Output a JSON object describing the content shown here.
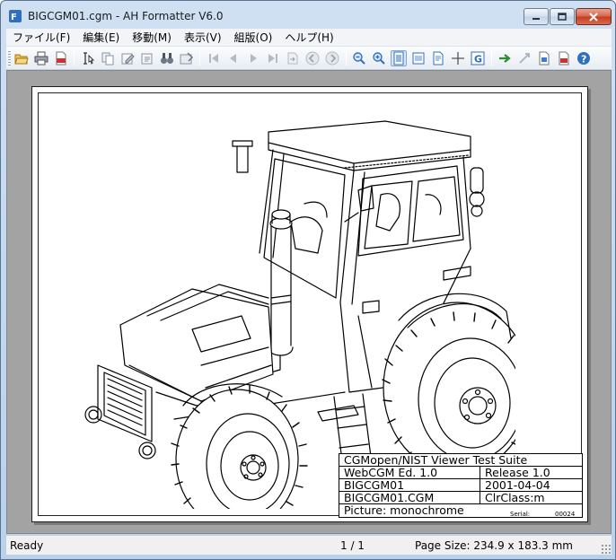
{
  "window": {
    "title": "BIGCGM01.cgm - AH Formatter V6.0",
    "app_icon": "ah-formatter-icon"
  },
  "caption_buttons": [
    {
      "name": "minimize",
      "icon": "minimize-icon"
    },
    {
      "name": "maximize",
      "icon": "maximize-icon"
    },
    {
      "name": "close",
      "icon": "close-icon"
    }
  ],
  "menu": [
    {
      "label": "ファイル(F)"
    },
    {
      "label": "編集(E)"
    },
    {
      "label": "移動(M)"
    },
    {
      "label": "表示(V)"
    },
    {
      "label": "組版(O)"
    },
    {
      "label": "ヘルプ(H)"
    }
  ],
  "toolbar": {
    "buttons": [
      {
        "name": "open",
        "icon": "open-folder-icon"
      },
      {
        "name": "print",
        "icon": "printer-icon"
      },
      {
        "name": "pdf",
        "icon": "pdf-icon"
      },
      {
        "name": "select-text",
        "icon": "text-select-icon"
      },
      {
        "name": "copy",
        "icon": "copy-icon"
      },
      {
        "name": "edit-1",
        "icon": "edit-icon"
      },
      {
        "name": "edit-2",
        "icon": "edit-icon"
      },
      {
        "name": "find",
        "icon": "binoculars-icon"
      },
      {
        "name": "settings",
        "icon": "options-icon"
      },
      {
        "name": "first-page",
        "icon": "first-page-icon"
      },
      {
        "name": "previous-page",
        "icon": "previous-page-icon"
      },
      {
        "name": "next-page",
        "icon": "next-page-icon"
      },
      {
        "name": "last-page",
        "icon": "last-page-icon"
      },
      {
        "name": "goto-page",
        "icon": "goto-icon"
      },
      {
        "name": "back",
        "icon": "back-icon"
      },
      {
        "name": "forward",
        "icon": "forward-icon"
      },
      {
        "name": "zoom-out",
        "icon": "zoom-out-icon"
      },
      {
        "name": "zoom-in",
        "icon": "zoom-in-icon"
      },
      {
        "name": "fit-page",
        "icon": "fit-page-icon"
      },
      {
        "name": "fit-width",
        "icon": "fit-width-icon"
      },
      {
        "name": "single-page",
        "icon": "single-page-icon"
      },
      {
        "name": "crosshair",
        "icon": "crosshair-icon"
      },
      {
        "name": "google",
        "icon": "g-icon"
      },
      {
        "name": "format",
        "icon": "run-format-icon"
      },
      {
        "name": "stop",
        "icon": "stop-icon"
      },
      {
        "name": "export-1",
        "icon": "export-icon"
      },
      {
        "name": "export-2",
        "icon": "export-pdf-icon"
      },
      {
        "name": "help",
        "icon": "help-icon"
      }
    ]
  },
  "document": {
    "drawing": "tractor-line-drawing",
    "titleblock": {
      "heading": "CGMopen/NIST Viewer Test Suite",
      "rows": [
        {
          "left": "WebCGM Ed. 1.0",
          "right": "Release 1.0"
        },
        {
          "left": "BIGCGM01",
          "right": "2001-04-04"
        },
        {
          "left": "BIGCGM01.CGM",
          "right": "ClrClass:m"
        }
      ],
      "picture": "Picture: monochrome",
      "serial_label": "Serial:",
      "serial_value": "00024"
    }
  },
  "status": {
    "ready": "Ready",
    "pages": "1 / 1",
    "page_size": "Page Size: 234.9 x 183.3 mm"
  },
  "colors": {
    "accent": "#2f6fbf",
    "close_button": "#c43c1f"
  }
}
